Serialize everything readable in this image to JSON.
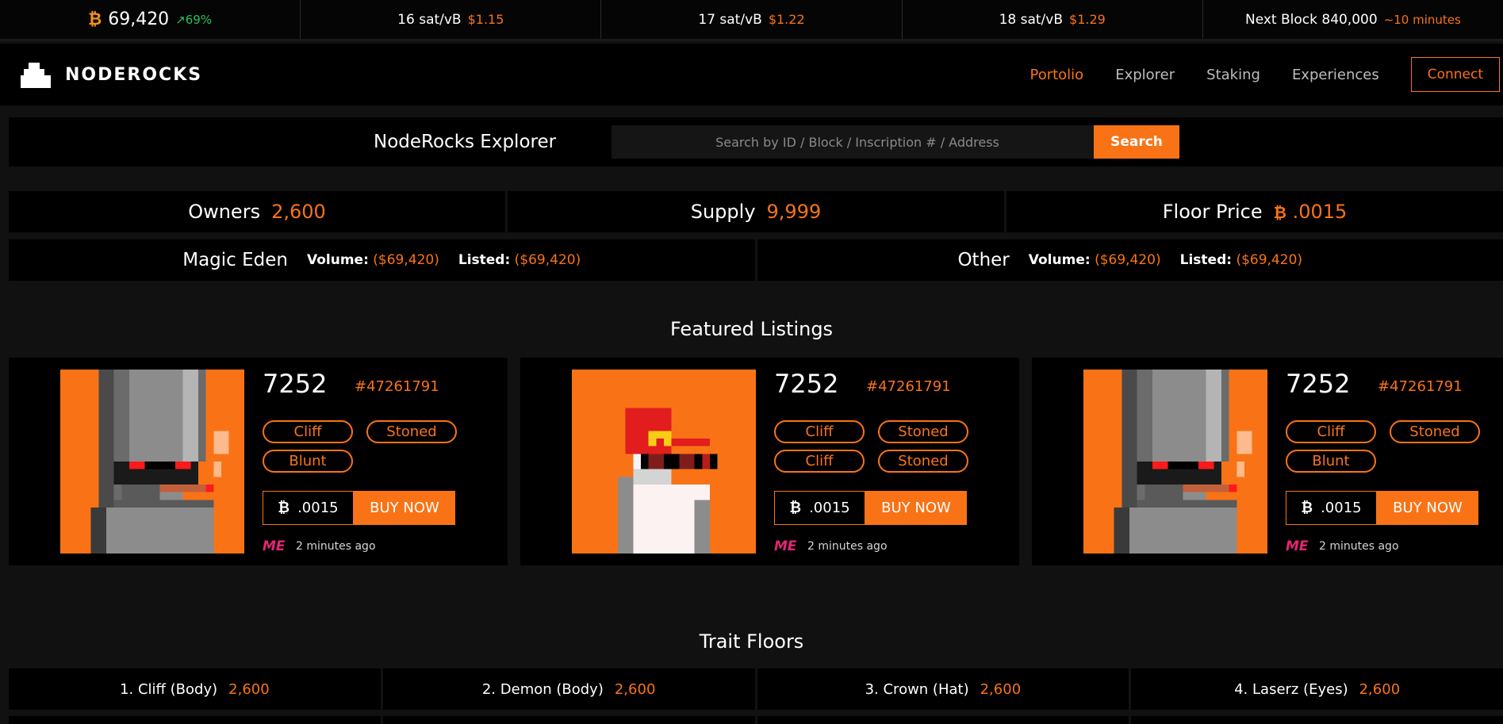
{
  "ticker": {
    "btc_price": "69,420",
    "btc_change": "↗69%",
    "fees": [
      {
        "rate": "16 sat/vB",
        "usd": "$1.15"
      },
      {
        "rate": "17 sat/vB",
        "usd": "$1.22"
      },
      {
        "rate": "18 sat/vB",
        "usd": "$1.29"
      }
    ],
    "next_block_label": "Next Block 840,000",
    "next_block_eta": "~10 minutes"
  },
  "nav": {
    "brand": "NODEROCKS",
    "links": [
      "Portolio",
      "Explorer",
      "Staking",
      "Experiences"
    ],
    "connect": "Connect"
  },
  "explorer": {
    "title": "NodeRocks Explorer",
    "placeholder": "Search by ID / Block / Inscription # / Address",
    "search_label": "Search"
  },
  "stats": [
    {
      "label": "Owners",
      "value": "2,600"
    },
    {
      "label": "Supply",
      "value": "9,999"
    },
    {
      "label": "Floor Price",
      "value": ".0015"
    }
  ],
  "markets": [
    {
      "name": "Magic Eden",
      "volume_label": "Volume:",
      "volume": "($69,420)",
      "listed_label": "Listed:",
      "listed": "($69,420)"
    },
    {
      "name": "Other",
      "volume_label": "Volume:",
      "volume": "($69,420)",
      "listed_label": "Listed:",
      "listed": "($69,420)"
    }
  ],
  "featured": {
    "title": "Featured Listings",
    "cards": [
      {
        "id": "7252",
        "inscription": "#47261791",
        "traits": [
          "Cliff",
          "Stoned",
          "Blunt"
        ],
        "price": ".0015",
        "buy": "BUY NOW",
        "time": "2 minutes ago"
      },
      {
        "id": "7252",
        "inscription": "#47261791",
        "traits": [
          "Cliff",
          "Stoned",
          "Cliff",
          "Stoned"
        ],
        "price": ".0015",
        "buy": "BUY NOW",
        "time": "2 minutes ago"
      },
      {
        "id": "7252",
        "inscription": "#47261791",
        "traits": [
          "Cliff",
          "Stoned",
          "Blunt"
        ],
        "price": ".0015",
        "buy": "BUY NOW",
        "time": "2 minutes ago"
      }
    ]
  },
  "trait_floors": {
    "title": "Trait Floors",
    "items": [
      {
        "label": "1. Cliff (Body)",
        "value": "2,600"
      },
      {
        "label": "2. Demon (Body)",
        "value": "2,600"
      },
      {
        "label": "3. Crown (Hat)",
        "value": "2,600"
      },
      {
        "label": "4. Laserz (Eyes)",
        "value": "2,600"
      }
    ]
  },
  "colors": {
    "accent": "#f97316",
    "background": "#111111",
    "panel": "#000000",
    "magic_eden": "#e42575"
  }
}
